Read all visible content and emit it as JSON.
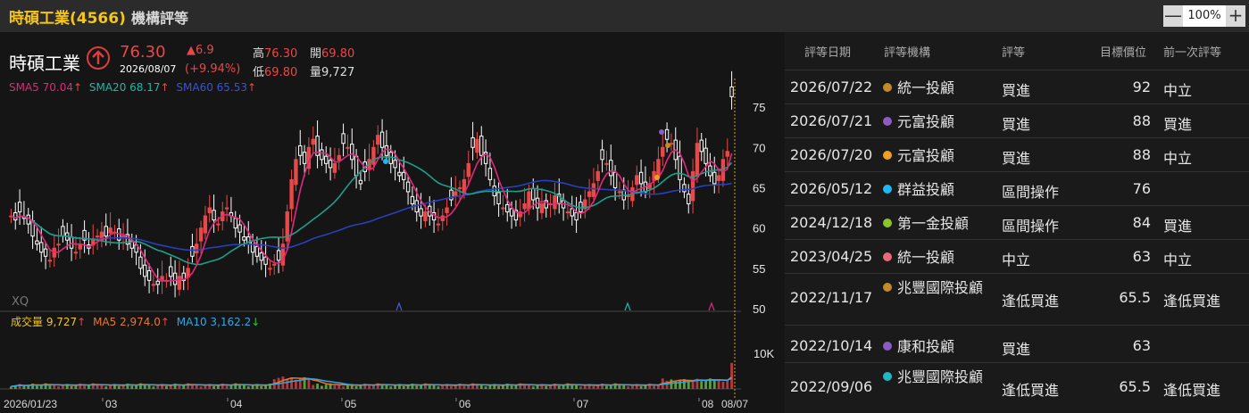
{
  "titlebar": {
    "title": "時碩工業(4566)",
    "subtitle": "機構評等",
    "zoom_value": "100%",
    "zoom_out": "—",
    "zoom_in": "+"
  },
  "quote": {
    "name": "時碩工業",
    "price": "76.30",
    "date": "2026/08/07",
    "change": "▲6.9",
    "change_pct": "(+9.94%)",
    "high_label": "高",
    "high": "76.30",
    "open_label": "開",
    "open": "69.80",
    "low_label": "低",
    "low": "69.80",
    "vol_label": "量",
    "vol": "9,727"
  },
  "ma": {
    "sma5": "SMA5 70.04",
    "sma20": "SMA20 68.17",
    "sma60": "SMA60 65.53",
    "arrow": "↑"
  },
  "volume": {
    "label": "成交量 9,727",
    "ma5": "MA5 2,974.0",
    "ma10": "MA10 3,162.2",
    "up": "↑",
    "down": "↓"
  },
  "watermark": "XQ",
  "colors": {
    "up": "#e84848",
    "down": "#ffffff",
    "sma5": "#e0297a",
    "sma20": "#1f9e8c",
    "sma60": "#2a3fbf",
    "vol_label": "#f5c518",
    "vol_ma5": "#e8772e",
    "vol_ma10": "#2fa8e6"
  },
  "chart_data": {
    "type": "candlestick",
    "y_ticks": [
      "75",
      "70",
      "65",
      "60",
      "55",
      "50"
    ],
    "ylim": [
      50,
      77
    ],
    "vol_tick": "10K",
    "x_ticks": [
      "2026/01/23",
      "03",
      "04",
      "05",
      "06",
      "07",
      "08",
      "08/07"
    ],
    "closes": [
      61.5,
      61.0,
      62.0,
      61.2,
      60.5,
      59.0,
      58.0,
      57.0,
      56.5,
      56.0,
      57.5,
      58.0,
      59.0,
      58.5,
      57.5,
      57.0,
      58.0,
      58.5,
      57.5,
      58.5,
      59.0,
      59.5,
      59.0,
      60.0,
      59.5,
      58.5,
      59.0,
      58.0,
      57.5,
      57.0,
      55.0,
      54.0,
      53.5,
      53.0,
      53.0,
      54.0,
      53.5,
      54.0,
      53.0,
      54.0,
      53.5,
      55.0,
      56.5,
      58.0,
      60.0,
      61.5,
      62.5,
      61.0,
      60.5,
      62.0,
      62.5,
      61.5,
      60.0,
      59.5,
      58.5,
      58.0,
      57.0,
      56.5,
      56.0,
      55.5,
      55.0,
      55.5,
      56.0,
      58.0,
      62.0,
      66.0,
      68.5,
      69.0,
      68.0,
      70.0,
      71.0,
      69.0,
      68.5,
      68.0,
      67.5,
      68.0,
      69.0,
      70.5,
      70.0,
      68.5,
      66.5,
      65.5,
      67.0,
      68.5,
      70.0,
      71.5,
      70.0,
      69.0,
      68.0,
      67.5,
      66.5,
      66.0,
      64.5,
      63.0,
      62.0,
      61.5,
      62.0,
      61.5,
      61.0,
      60.5,
      61.5,
      62.5,
      63.5,
      64.5,
      65.0,
      66.0,
      68.0,
      70.0,
      71.0,
      69.0,
      68.0,
      66.0,
      64.0,
      63.0,
      62.5,
      62.0,
      61.5,
      61.0,
      62.0,
      63.0,
      64.5,
      63.5,
      62.5,
      63.0,
      62.5,
      63.0,
      64.0,
      63.0,
      62.5,
      62.0,
      61.5,
      61.0,
      62.0,
      63.5,
      64.5,
      65.5,
      67.0,
      68.5,
      68.0,
      66.5,
      65.0,
      64.5,
      63.5,
      64.0,
      65.0,
      66.5,
      65.5,
      64.5,
      65.5,
      67.0,
      68.5,
      70.0,
      71.0,
      70.5,
      68.5,
      66.0,
      64.5,
      63.0,
      67.0,
      70.5,
      69.5,
      68.0,
      66.5,
      65.5,
      66.5,
      68.5,
      69.5,
      76.3
    ],
    "volume_max": 12000
  },
  "ratings": {
    "headers": [
      "評等日期",
      "評等機構",
      "評等",
      "目標價位",
      "前一次評等"
    ],
    "rows": [
      {
        "date": "2026/07/22",
        "org": "統一投顧",
        "rating": "買進",
        "target": "92",
        "prev": "中立",
        "dot": "#c48a2a"
      },
      {
        "date": "2026/07/21",
        "org": "元富投顧",
        "rating": "買進",
        "target": "88",
        "prev": "買進",
        "dot": "#8a5cc4"
      },
      {
        "date": "2026/07/20",
        "org": "元富投顧",
        "rating": "買進",
        "target": "88",
        "prev": "中立",
        "dot": "#f0a020"
      },
      {
        "date": "2026/05/12",
        "org": "群益投顧",
        "rating": "區間操作",
        "target": "76",
        "prev": "",
        "dot": "#20b8f0"
      },
      {
        "date": "2024/12/18",
        "org": "第一金投顧",
        "rating": "區間操作",
        "target": "84",
        "prev": "買進",
        "dot": "#8ac42a"
      },
      {
        "date": "2023/04/25",
        "org": "統一投顧",
        "rating": "中立",
        "target": "63",
        "prev": "中立",
        "dot": "#e86a78"
      },
      {
        "date": "2022/11/17",
        "org": "兆豐國際投顧",
        "rating": "逢低買進",
        "target": "65.5",
        "prev": "逢低買進",
        "dot": "#c48a2a"
      },
      {
        "date": "2022/10/14",
        "org": "康和投顧",
        "rating": "買進",
        "target": "63",
        "prev": "",
        "dot": "#8a5cc4"
      },
      {
        "date": "2022/09/06",
        "org": "兆豐國際投顧",
        "rating": "逢低買進",
        "target": "65.5",
        "prev": "逢低買進",
        "dot": "#20b8c4"
      }
    ]
  }
}
